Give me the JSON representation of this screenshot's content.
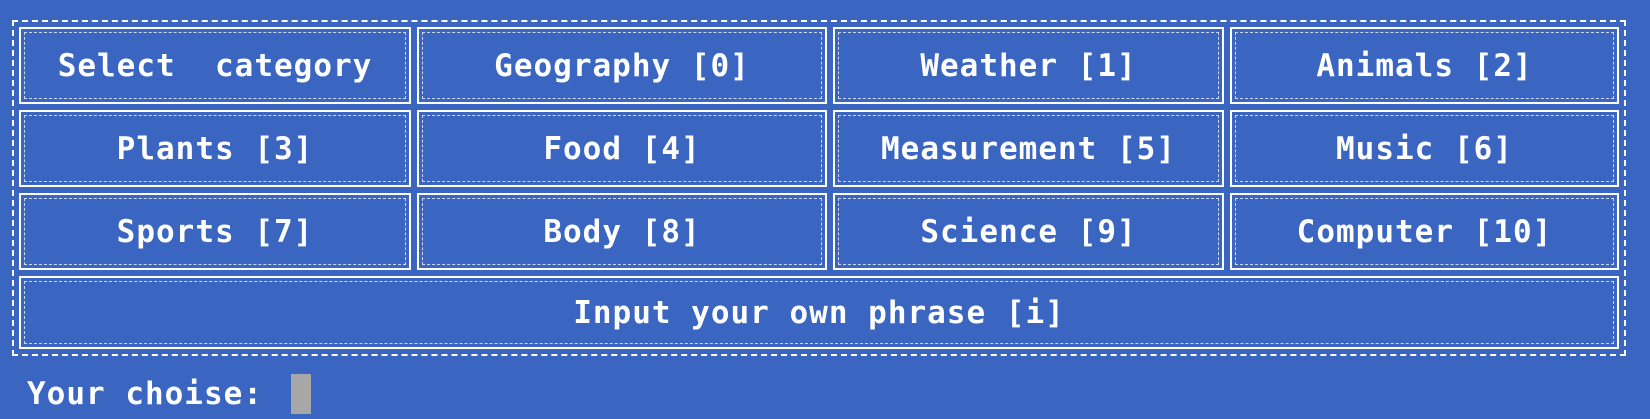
{
  "menu": {
    "header": "Select  category",
    "options": [
      "Geography [0]",
      "Weather [1]",
      "Animals [2]",
      "Plants [3]",
      "Food [4]",
      "Measurement [5]",
      "Music [6]",
      "Sports [7]",
      "Body [8]",
      "Science [9]",
      "Computer [10]"
    ],
    "custom": "Input your own phrase [i]"
  },
  "prompt": {
    "label": "Your choise: ",
    "value": ""
  },
  "colors": {
    "background": "#3a66c2",
    "text": "#ffffff",
    "cursor": "#a7a7a7"
  }
}
